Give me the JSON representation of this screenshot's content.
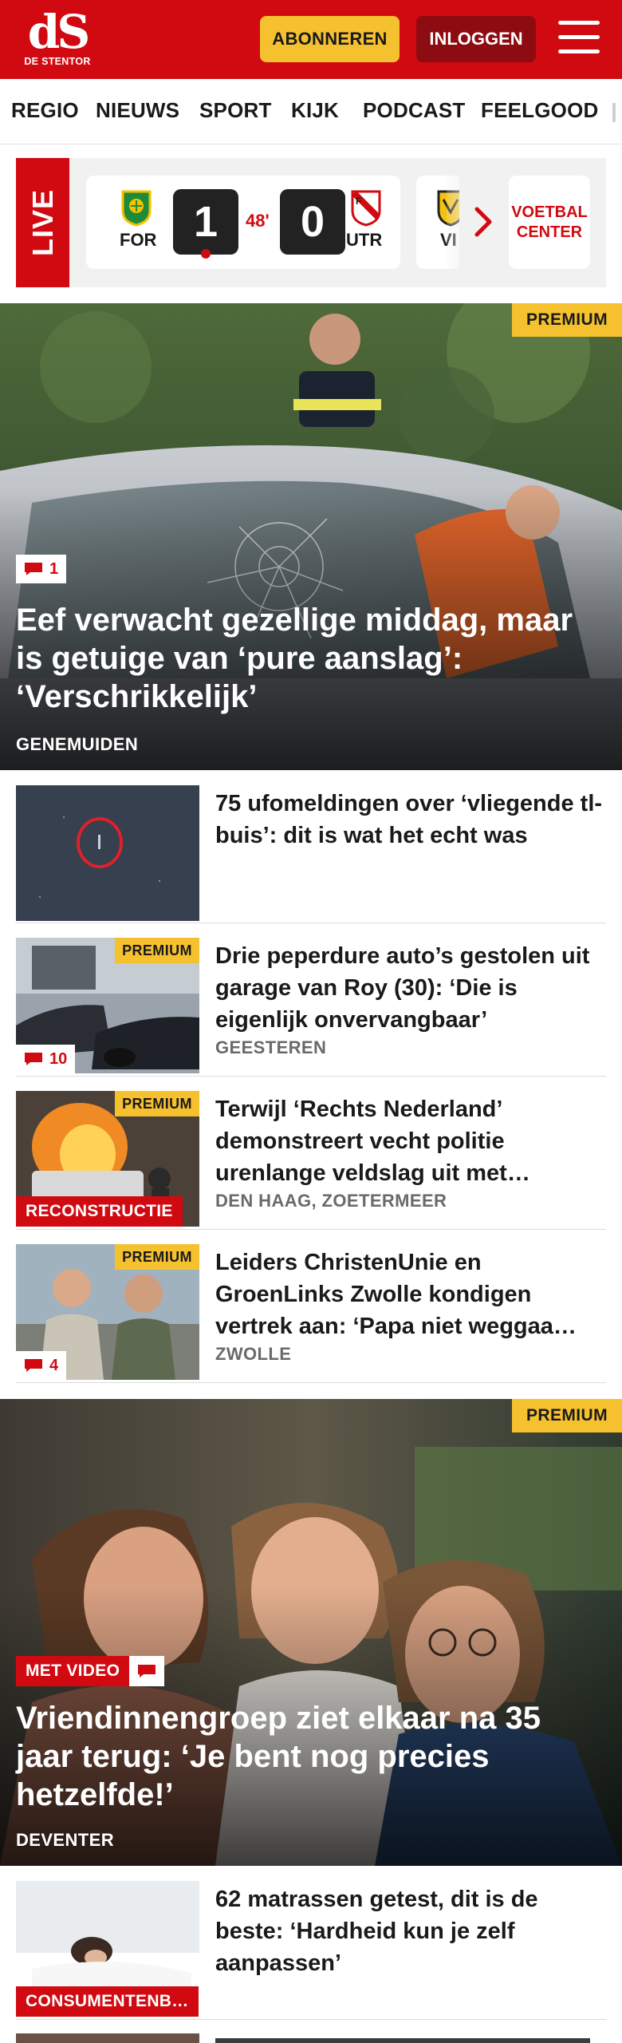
{
  "header": {
    "logo_mark": "dS",
    "logo_sub": "DE STENTOR",
    "subscribe_label": "ABONNEREN",
    "login_label": "INLOGGEN",
    "menu_icon": "hamburger-menu-icon"
  },
  "nav": {
    "items": [
      "REGIO",
      "NIEUWS",
      "SPORT",
      "KIJK",
      "PODCAST",
      "FEELGOOD"
    ]
  },
  "live": {
    "tab_label": "LIVE",
    "match": {
      "home_code": "FOR",
      "away_code": "UTR",
      "home_score": "1",
      "away_score": "0",
      "minute": "48'"
    },
    "next_card_code": "VI",
    "voetbalcenter_label": "VOETBAL CENTER"
  },
  "hero1": {
    "premium": "PREMIUM",
    "comments": "1",
    "title": "Eef verwacht gezellige middag, maar is getuige van ‘pure aanslag’: ‘Verschrikkelijk’",
    "place": "GENEMUIDEN"
  },
  "articles": [
    {
      "title": "75 ufomeldingen over ‘vliegende tl-buis’: dit is wat het echt was",
      "place": ""
    },
    {
      "title": "Drie peperdure auto’s gestolen uit garage van Roy (30): ‘Die is eigenlijk onvervangbaar’",
      "place": "GEESTEREN",
      "premium": "PREMIUM",
      "comments": "10"
    },
    {
      "title": "Terwijl ‘Rechts Nederland’ demonstreert vecht politie urenlange veldslag uit met…",
      "place": "DEN HAAG, ZOETERMEER",
      "premium": "PREMIUM",
      "label": "RECONSTRUCTIE"
    },
    {
      "title": "Leiders ChristenUnie en GroenLinks Zwolle kondigen vertrek aan: ‘Papa niet weggaa…",
      "place": "ZWOLLE",
      "premium": "PREMIUM",
      "comments": "4"
    },
    {
      "title": "62 matrassen getest, dit is de beste: ‘Hardheid kun je zelf aanpassen’",
      "place": "",
      "label": "CONSUMENTENB…"
    }
  ],
  "hero2": {
    "premium": "PREMIUM",
    "video_label": "MET VIDEO",
    "title": "Vriendinnengroep ziet elkaar na 35 jaar terug: ‘Je bent nog precies hetzelfde!’",
    "place": "DEVENTER"
  },
  "colors": {
    "brand_red": "#d10a11",
    "dark_red": "#8d0c11",
    "premium_yellow": "#f6c12e"
  }
}
